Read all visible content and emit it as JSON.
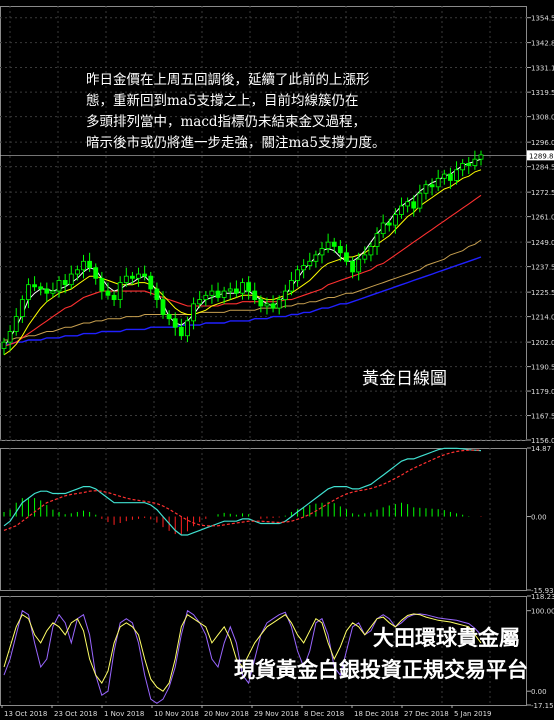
{
  "annotation": {
    "lines": [
      "昨日金價在上周五回調後，延續了此前的上漲形",
      "態，重新回到ma5支撐之上，目前均線簇仍在",
      "多頭排列當中，macd指標仍未結束金叉過程，",
      "暗示後市或仍將進一步走強，關注ma5支撐力度。"
    ]
  },
  "caption": "黃金日線圖",
  "branding": {
    "line1": "大田環球貴金屬",
    "line2": "現貨黃金白銀投資正規交易平台"
  },
  "colors": {
    "background": "#000000",
    "grid": "#3a3a3a",
    "candle": "#00ff00",
    "ma5": "#ffffff",
    "ma10": "#ffff00",
    "ma20": "#ff3030",
    "ma40": "#c8a050",
    "ma60": "#2020ff",
    "macd_line": "#40e0d0",
    "signal_line": "#ff3030",
    "stoch_k": "#ffff66",
    "stoch_d": "#9966ff"
  },
  "chart_data": [
    {
      "type": "candlestick",
      "title": "",
      "x": [
        "13 Oct 2018",
        "23 Oct 2018",
        "1 Nov 2018",
        "10 Nov 2018",
        "20 Nov 2018",
        "29 Nov 2018",
        "8 Dec 2018",
        "18 Dec 2018",
        "27 Dec 2018",
        "5 Jan 2019"
      ],
      "y_ticks": [
        "1354.5",
        "1342.8",
        "1331.1",
        "1319.5",
        "1308.0",
        "1296.0",
        "1284.5",
        "1272.5",
        "1261.0",
        "1249.0",
        "1237.5",
        "1225.5",
        "1214.0",
        "1202.0",
        "1190.5",
        "1179.0",
        "1167.5",
        "1156.0"
      ],
      "ylim": [
        1156.0,
        1360
      ],
      "last_price": "1289.8",
      "close": [
        1202,
        1207,
        1214,
        1222,
        1229,
        1228,
        1227,
        1225,
        1226,
        1231,
        1229,
        1234,
        1236,
        1240,
        1237,
        1232,
        1226,
        1224,
        1222,
        1230,
        1233,
        1232,
        1234,
        1233,
        1227,
        1222,
        1215,
        1213,
        1209,
        1205,
        1212,
        1220,
        1222,
        1224,
        1226,
        1223,
        1226,
        1227,
        1225,
        1230,
        1226,
        1222,
        1219,
        1220,
        1218,
        1222,
        1226,
        1231,
        1236,
        1238,
        1240,
        1243,
        1246,
        1249,
        1247,
        1244,
        1240,
        1235,
        1241,
        1243,
        1247,
        1253,
        1258,
        1257,
        1262,
        1266,
        1268,
        1265,
        1272,
        1276,
        1275,
        1279,
        1281,
        1278,
        1283,
        1286,
        1285,
        1288,
        1290
      ],
      "ma5": [
        1200,
        1204,
        1209,
        1215,
        1222,
        1225,
        1227,
        1227,
        1226,
        1227,
        1228,
        1230,
        1232,
        1235,
        1237,
        1236,
        1232,
        1228,
        1226,
        1227,
        1229,
        1230,
        1232,
        1233,
        1230,
        1226,
        1220,
        1214,
        1211,
        1210,
        1212,
        1215,
        1219,
        1222,
        1223,
        1224,
        1225,
        1225,
        1225,
        1226,
        1226,
        1224,
        1222,
        1220,
        1219,
        1221,
        1224,
        1228,
        1232,
        1236,
        1239,
        1242,
        1245,
        1246,
        1245,
        1242,
        1240,
        1240,
        1242,
        1245,
        1249,
        1253,
        1256,
        1259,
        1263,
        1266,
        1268,
        1270,
        1273,
        1275,
        1277,
        1278,
        1280,
        1281,
        1283,
        1285,
        1286,
        1287,
        1288
      ],
      "ma10": [
        1196,
        1198,
        1201,
        1205,
        1210,
        1214,
        1218,
        1221,
        1223,
        1225,
        1226,
        1227,
        1229,
        1231,
        1233,
        1233,
        1232,
        1231,
        1230,
        1229,
        1229,
        1229,
        1230,
        1230,
        1229,
        1227,
        1224,
        1221,
        1218,
        1216,
        1215,
        1215,
        1216,
        1217,
        1219,
        1220,
        1221,
        1222,
        1223,
        1224,
        1224,
        1224,
        1223,
        1222,
        1222,
        1223,
        1224,
        1225,
        1227,
        1229,
        1231,
        1234,
        1237,
        1239,
        1240,
        1241,
        1242,
        1242,
        1243,
        1244,
        1246,
        1248,
        1250,
        1252,
        1255,
        1258,
        1261,
        1263,
        1266,
        1268,
        1270,
        1272,
        1274,
        1275,
        1277,
        1279,
        1280,
        1282,
        1283
      ],
      "ma20": [
        1200,
        1201,
        1202,
        1204,
        1206,
        1208,
        1210,
        1212,
        1214,
        1216,
        1218,
        1219,
        1221,
        1223,
        1224,
        1225,
        1226,
        1226,
        1226,
        1226,
        1226,
        1226,
        1226,
        1226,
        1225,
        1224,
        1223,
        1222,
        1221,
        1220,
        1219,
        1219,
        1219,
        1219,
        1219,
        1219,
        1220,
        1220,
        1220,
        1221,
        1221,
        1221,
        1221,
        1221,
        1221,
        1221,
        1222,
        1222,
        1223,
        1224,
        1225,
        1226,
        1227,
        1229,
        1230,
        1231,
        1232,
        1233,
        1234,
        1235,
        1236,
        1238,
        1239,
        1241,
        1243,
        1245,
        1247,
        1249,
        1251,
        1253,
        1255,
        1257,
        1259,
        1261,
        1263,
        1265,
        1267,
        1269,
        1271
      ],
      "ma40": [
        1203,
        1203,
        1204,
        1204,
        1205,
        1205,
        1206,
        1207,
        1207,
        1208,
        1209,
        1209,
        1210,
        1211,
        1211,
        1212,
        1212,
        1213,
        1213,
        1213,
        1214,
        1214,
        1214,
        1215,
        1215,
        1215,
        1215,
        1215,
        1215,
        1215,
        1215,
        1215,
        1216,
        1216,
        1216,
        1216,
        1216,
        1217,
        1217,
        1217,
        1217,
        1217,
        1218,
        1218,
        1218,
        1218,
        1219,
        1219,
        1220,
        1220,
        1221,
        1221,
        1222,
        1223,
        1223,
        1224,
        1225,
        1225,
        1226,
        1227,
        1228,
        1229,
        1230,
        1231,
        1232,
        1233,
        1234,
        1235,
        1236,
        1238,
        1239,
        1240,
        1241,
        1243,
        1244,
        1245,
        1247,
        1248,
        1250
      ],
      "ma60": [
        1201,
        1201,
        1202,
        1202,
        1203,
        1203,
        1203,
        1204,
        1204,
        1204,
        1205,
        1205,
        1205,
        1206,
        1206,
        1206,
        1207,
        1207,
        1207,
        1207,
        1208,
        1208,
        1208,
        1208,
        1209,
        1209,
        1209,
        1209,
        1209,
        1210,
        1210,
        1210,
        1210,
        1211,
        1211,
        1211,
        1211,
        1212,
        1212,
        1212,
        1212,
        1213,
        1213,
        1213,
        1214,
        1214,
        1214,
        1215,
        1215,
        1216,
        1216,
        1217,
        1218,
        1218,
        1219,
        1220,
        1220,
        1221,
        1222,
        1223,
        1224,
        1225,
        1226,
        1227,
        1228,
        1229,
        1230,
        1231,
        1232,
        1233,
        1234,
        1235,
        1236,
        1237,
        1238,
        1239,
        1240,
        1241,
        1242
      ]
    },
    {
      "type": "line",
      "title": "",
      "y_ticks": [
        "14.87",
        "0.00",
        "-15.93"
      ],
      "ylim": [
        -15.93,
        14.87
      ],
      "macd": [
        -2,
        -1,
        1,
        3,
        4,
        5,
        5.5,
        5.5,
        5,
        5,
        5,
        5.5,
        6,
        6.5,
        6.5,
        6,
        5,
        4,
        3,
        3,
        3,
        3,
        3,
        3,
        2.5,
        1.5,
        0,
        -1.5,
        -3,
        -4,
        -4,
        -3.5,
        -3,
        -2.5,
        -2,
        -1.5,
        -1,
        -1,
        -1,
        -0.5,
        -0.5,
        -1,
        -1.5,
        -1.5,
        -1.5,
        -1.5,
        -1,
        0,
        1,
        2,
        3,
        4,
        5,
        6,
        6.5,
        6.5,
        6.5,
        6,
        6,
        6.5,
        7,
        8,
        9,
        10,
        11,
        12,
        12.5,
        12.5,
        13,
        13.5,
        14,
        14.5,
        14.8,
        14.8,
        14.8,
        14.7,
        14.5,
        14.4,
        14.3
      ],
      "signal": [
        -3,
        -2.5,
        -2,
        -1,
        0,
        1,
        2,
        3,
        3.5,
        4,
        4.5,
        4.8,
        5,
        5.2,
        5.5,
        5.6,
        5.5,
        5.2,
        4.8,
        4.4,
        4,
        3.7,
        3.5,
        3.3,
        3.1,
        2.8,
        2.3,
        1.6,
        0.8,
        0,
        -0.8,
        -1.4,
        -1.8,
        -2,
        -2,
        -2,
        -1.8,
        -1.6,
        -1.4,
        -1.2,
        -1,
        -1,
        -1,
        -1.1,
        -1.2,
        -1.3,
        -1.2,
        -1,
        -0.6,
        -0.1,
        0.5,
        1.2,
        2,
        2.8,
        3.6,
        4.3,
        4.9,
        5.3,
        5.6,
        5.8,
        6.1,
        6.5,
        7,
        7.6,
        8.3,
        9,
        9.8,
        10.5,
        11.1,
        11.7,
        12.3,
        12.9,
        13.4,
        13.8,
        14.1,
        14.3,
        14.4,
        14.4,
        14.4
      ]
    },
    {
      "type": "line",
      "title": "",
      "y_ticks": [
        "118.235",
        "100.00",
        "0.00",
        "-17.151"
      ],
      "ylim": [
        -17.151,
        118.235
      ],
      "stoch_k": [
        30,
        55,
        80,
        95,
        90,
        70,
        60,
        75,
        85,
        80,
        70,
        85,
        90,
        75,
        40,
        20,
        10,
        25,
        60,
        80,
        85,
        80,
        70,
        40,
        15,
        5,
        0,
        10,
        40,
        80,
        95,
        90,
        85,
        80,
        60,
        70,
        80,
        65,
        40,
        30,
        45,
        60,
        70,
        80,
        85,
        90,
        95,
        85,
        70,
        60,
        75,
        90,
        85,
        60,
        40,
        55,
        75,
        85,
        80,
        70,
        80,
        90,
        92,
        85,
        80,
        88,
        94,
        96,
        95,
        92,
        90,
        88,
        87,
        86,
        84,
        82,
        80,
        70,
        60
      ],
      "stoch_d": [
        20,
        40,
        70,
        100,
        95,
        60,
        30,
        40,
        80,
        95,
        85,
        60,
        90,
        95,
        70,
        20,
        -5,
        0,
        50,
        85,
        90,
        85,
        60,
        20,
        -10,
        -15,
        -10,
        5,
        30,
        70,
        100,
        95,
        85,
        70,
        40,
        30,
        60,
        80,
        60,
        20,
        10,
        40,
        70,
        85,
        90,
        95,
        98,
        80,
        50,
        30,
        50,
        85,
        90,
        70,
        30,
        20,
        50,
        80,
        85,
        70,
        75,
        90,
        95,
        90,
        80,
        85,
        92,
        95,
        96,
        95,
        93,
        91,
        90,
        89,
        88,
        86,
        84,
        78,
        70
      ]
    }
  ]
}
